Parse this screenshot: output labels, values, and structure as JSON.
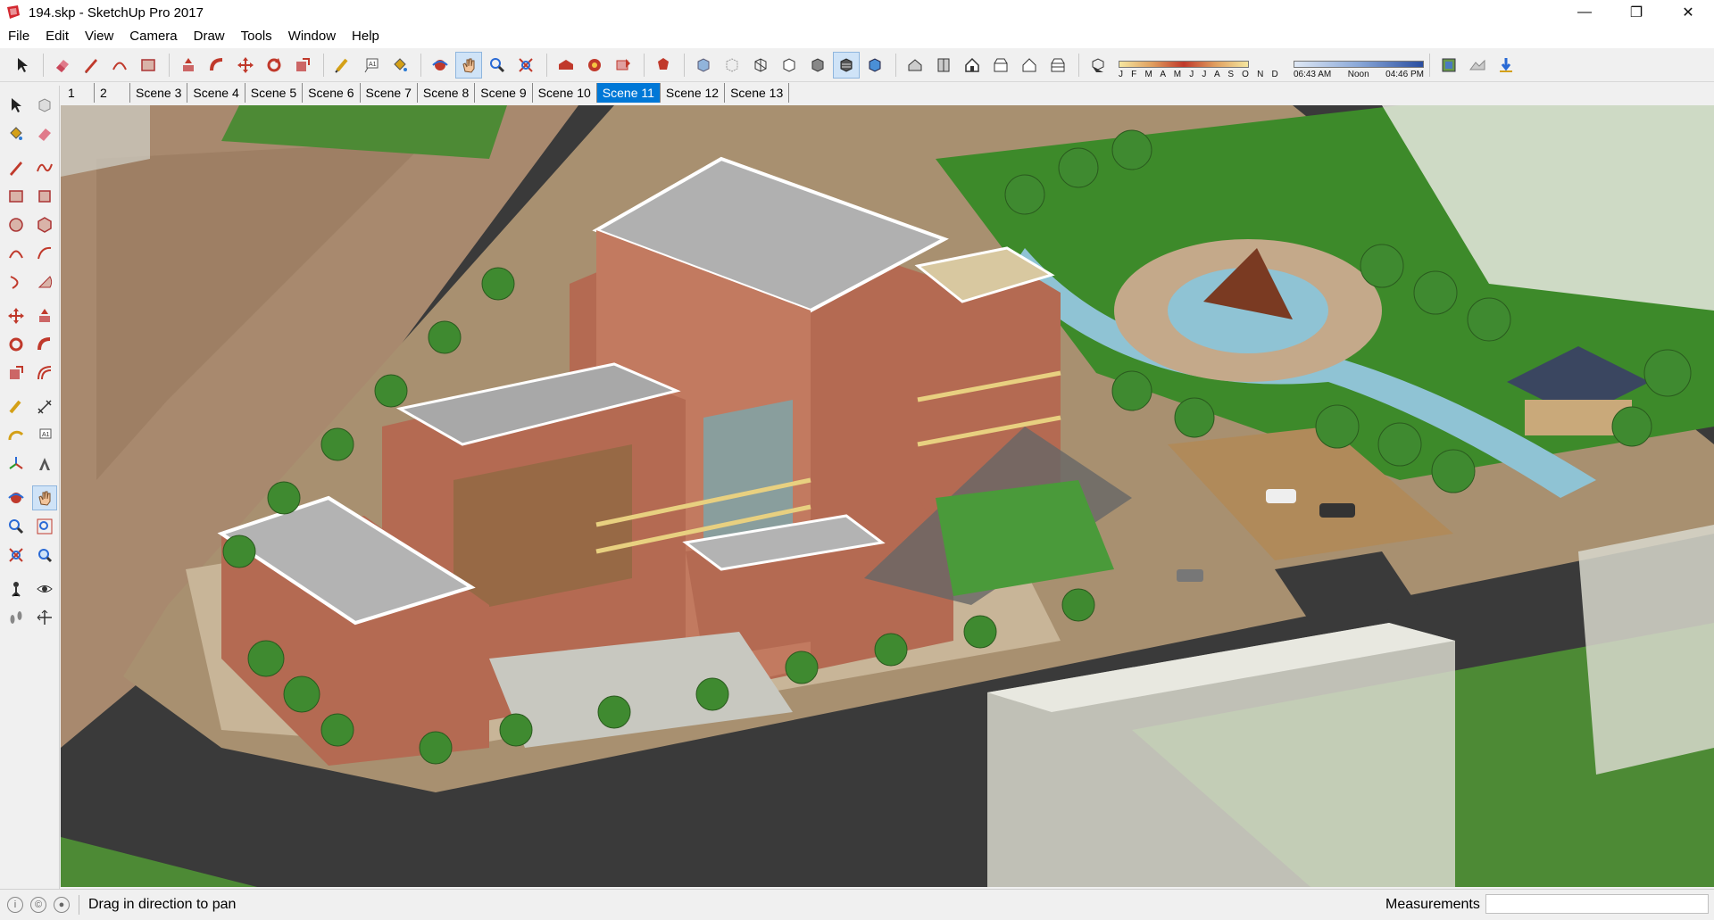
{
  "window": {
    "title": "194.skp - SketchUp Pro 2017",
    "minimize": "—",
    "maximize": "❐",
    "close": "✕"
  },
  "menu": [
    "File",
    "Edit",
    "View",
    "Camera",
    "Draw",
    "Tools",
    "Window",
    "Help"
  ],
  "shadow": {
    "months": "J F M A M J J A S O N D",
    "time_start": "06:43 AM",
    "time_mid": "Noon",
    "time_end": "04:46 PM"
  },
  "scenes": [
    "1",
    "2",
    "Scene 3",
    "Scene 4",
    "Scene 5",
    "Scene 6",
    "Scene 7",
    "Scene 8",
    "Scene 9",
    "Scene 10",
    "Scene 11",
    "Scene 12",
    "Scene 13"
  ],
  "active_scene": "Scene 11",
  "status": {
    "message": "Drag in direction to pan",
    "measurements_label": "Measurements",
    "measurements_value": ""
  },
  "colors": {
    "accent": "#0078d7",
    "road": "#3a3a3a",
    "brick": "#b46a52",
    "grass": "#3d8a2a",
    "roof": "#b0b0b0"
  }
}
